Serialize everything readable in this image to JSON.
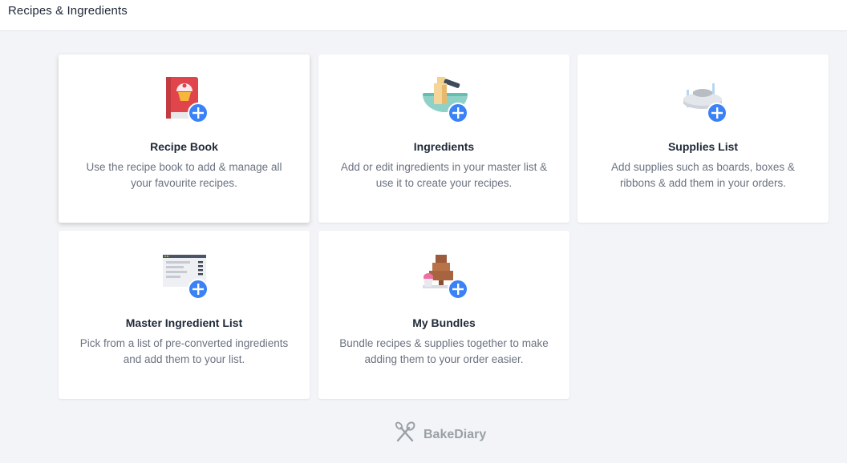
{
  "header": {
    "title": "Recipes & Ingredients"
  },
  "cards": [
    {
      "title": "Recipe Book",
      "description": "Use the recipe book to add & manage all your favourite recipes.",
      "icon": "recipe-book-icon"
    },
    {
      "title": "Ingredients",
      "description": "Add or edit ingredients in your master list & use it to create your recipes.",
      "icon": "mixing-bowl-icon"
    },
    {
      "title": "Supplies List",
      "description": "Add supplies such as boards, boxes & ribbons & add them in your orders.",
      "icon": "cake-board-icon"
    },
    {
      "title": "Master Ingredient List",
      "description": "Pick from a list of pre-converted ingredients and add them to your list.",
      "icon": "ingredient-list-icon"
    },
    {
      "title": "My Bundles",
      "description": "Bundle recipes & supplies together to make adding them to your order easier.",
      "icon": "bundle-boxes-icon"
    }
  ],
  "footer": {
    "brand": "BakeDiary",
    "logo_icon": "whisk-spoon-icon"
  },
  "colors": {
    "accent": "#3b82f6",
    "background": "#f3f4f7"
  }
}
